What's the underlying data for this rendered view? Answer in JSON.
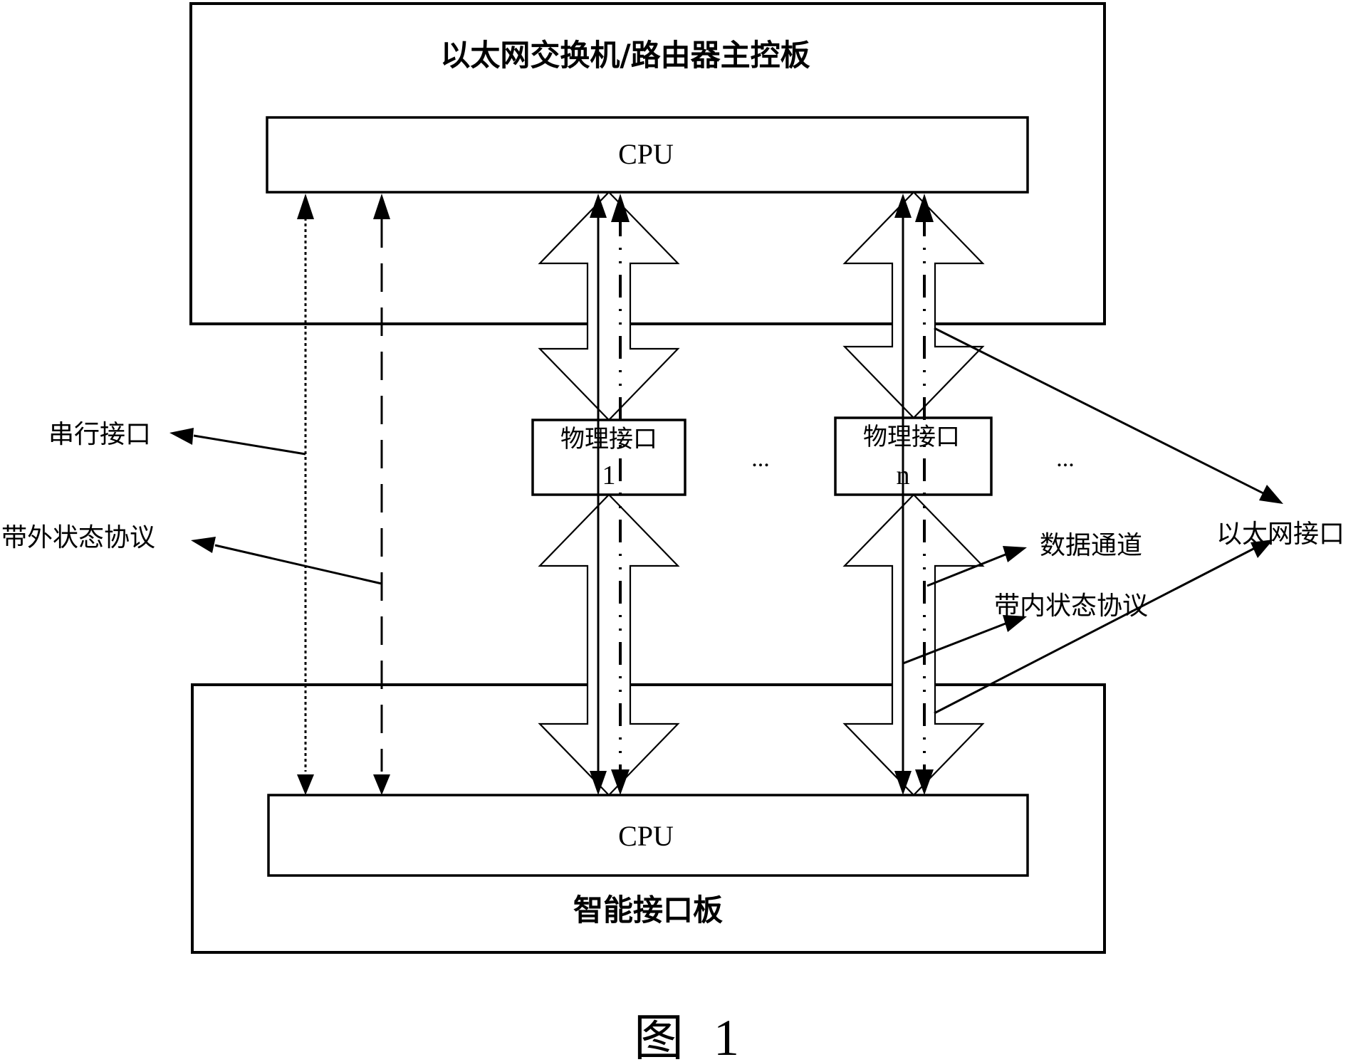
{
  "figure": {
    "caption_prefix": "图",
    "caption_number": "1"
  },
  "main_board": {
    "title": "以太网交换机/路由器主控板",
    "cpu_label": "CPU"
  },
  "interface_board": {
    "title": "智能接口板",
    "cpu_label": "CPU"
  },
  "physical_interfaces": [
    {
      "label": "物理接口",
      "index": "1"
    },
    {
      "label": "物理接口",
      "index": "n"
    }
  ],
  "ellipsis": "...",
  "callouts": {
    "serial_interface": "串行接口",
    "out_of_band_protocol": "带外状态协议",
    "data_channel": "数据通道",
    "in_band_protocol": "带内状态协议",
    "ethernet_interface": "以太网接口"
  },
  "line_styles": {
    "serial_interface": "dotted",
    "out_of_band_protocol": "dashed",
    "data_channel": "dash-dot",
    "in_band_protocol": "solid",
    "ethernet_interface": "block-arrow"
  },
  "colors": {
    "stroke": "#000000",
    "background": "#ffffff"
  }
}
